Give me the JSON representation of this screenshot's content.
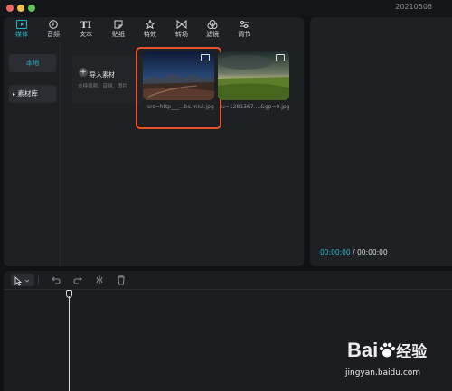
{
  "window": {
    "version": "20210506",
    "traffic_lights": [
      "#ed6a5e",
      "#f5bf4f",
      "#61c554"
    ]
  },
  "toolbar": {
    "items": [
      {
        "label": "媒体",
        "icon": "media-icon",
        "active": true
      },
      {
        "label": "音频",
        "icon": "audio-icon"
      },
      {
        "label": "文本",
        "icon": "text-icon"
      },
      {
        "label": "贴纸",
        "icon": "sticker-icon"
      },
      {
        "label": "特效",
        "icon": "effects-icon"
      },
      {
        "label": "转场",
        "icon": "transition-icon"
      },
      {
        "label": "滤镜",
        "icon": "filter-icon"
      },
      {
        "label": "调节",
        "icon": "adjust-icon"
      }
    ]
  },
  "sidebar": {
    "items": [
      {
        "label": "本地",
        "active": true
      },
      {
        "label": "素材库"
      }
    ]
  },
  "import": {
    "title": "导入素材",
    "subtitle": "支持视频、音频、图片"
  },
  "media": [
    {
      "filename": "src=http___...bs.miui.jpg",
      "selected": true
    },
    {
      "filename": "u=1281367....&gp=0.jpg"
    }
  ],
  "player": {
    "current_time": "00:00:00",
    "separator": "/",
    "total_time": "00:00:00"
  },
  "accent_color": "#23b6c7",
  "highlight_color": "#e8542a",
  "watermark": {
    "brand": "Bai",
    "brand_suffix": "经验",
    "url": "jingyan.baidu.com"
  }
}
